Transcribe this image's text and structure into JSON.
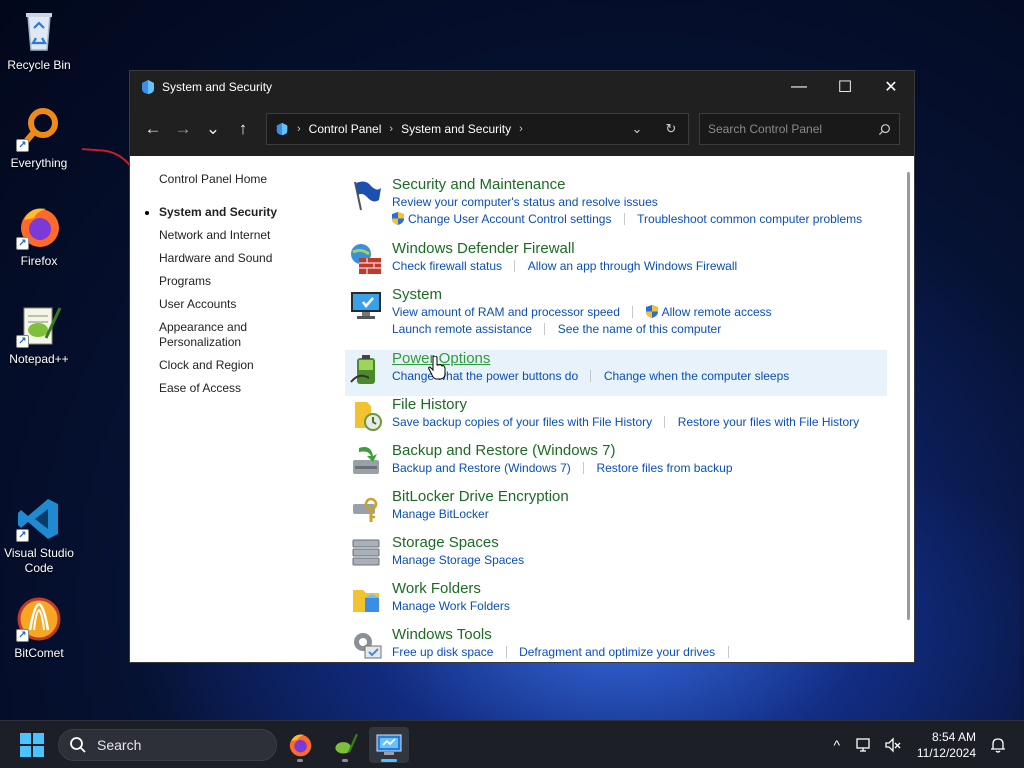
{
  "desktop": {
    "icons": [
      {
        "label": "Recycle Bin"
      },
      {
        "label": "Everything"
      },
      {
        "label": "Firefox"
      },
      {
        "label": "Notepad++"
      },
      {
        "label": "Visual Studio Code"
      },
      {
        "label": "BitComet"
      }
    ]
  },
  "window": {
    "title": "System and Security",
    "controls": {
      "minimize": "—",
      "maximize": "☐",
      "close": "✕"
    }
  },
  "nav": {
    "back": "←",
    "forward": "→",
    "recent": "⌄",
    "up": "↑",
    "breadcrumb": [
      "Control Panel",
      "System and Security"
    ],
    "crumb_sep": "›",
    "dropdown": "⌄",
    "refresh": "↻",
    "search_placeholder": "Search Control Panel"
  },
  "sidebar": {
    "items": [
      {
        "label": "Control Panel Home"
      },
      {
        "label": "System and Security"
      },
      {
        "label": "Network and Internet"
      },
      {
        "label": "Hardware and Sound"
      },
      {
        "label": "Programs"
      },
      {
        "label": "User Accounts"
      },
      {
        "label": "Appearance and Personalization"
      },
      {
        "label": "Clock and Region"
      },
      {
        "label": "Ease of Access"
      }
    ]
  },
  "categories": [
    {
      "title": "Security and Maintenance",
      "icon": "flag-icon",
      "rows": [
        [
          "Review your computer's status and resolve issues"
        ],
        [
          "Change User Account Control settings",
          "Troubleshoot common computer problems"
        ]
      ]
    },
    {
      "title": "Windows Defender Firewall",
      "icon": "firewall-icon",
      "rows": [
        [
          "Check firewall status",
          "Allow an app through Windows Firewall"
        ]
      ]
    },
    {
      "title": "System",
      "icon": "monitor-icon",
      "rows": [
        [
          "View amount of RAM and processor speed",
          "Allow remote access"
        ],
        [
          "Launch remote assistance",
          "See the name of this computer"
        ]
      ]
    },
    {
      "title": "Power Options",
      "icon": "battery-icon",
      "rows": [
        [
          "Change what the power buttons do",
          "Change when the computer sleeps"
        ]
      ]
    },
    {
      "title": "File History",
      "icon": "file-history-icon",
      "rows": [
        [
          "Save backup copies of your files with File History",
          "Restore your files with File History"
        ]
      ]
    },
    {
      "title": "Backup and Restore (Windows 7)",
      "icon": "backup-icon",
      "rows": [
        [
          "Backup and Restore (Windows 7)",
          "Restore files from backup"
        ]
      ]
    },
    {
      "title": "BitLocker Drive Encryption",
      "icon": "bitlocker-icon",
      "rows": [
        [
          "Manage BitLocker"
        ]
      ]
    },
    {
      "title": "Storage Spaces",
      "icon": "storage-icon",
      "rows": [
        [
          "Manage Storage Spaces"
        ]
      ]
    },
    {
      "title": "Work Folders",
      "icon": "work-folders-icon",
      "rows": [
        [
          "Manage Work Folders"
        ]
      ]
    },
    {
      "title": "Windows Tools",
      "icon": "tools-icon",
      "rows": [
        [
          "Free up disk space",
          "Defragment and optimize your drives"
        ]
      ]
    }
  ],
  "taskbar": {
    "search_label": "Search",
    "tray": {
      "chevron": "^",
      "time": "8:54 AM",
      "date": "11/12/2024"
    }
  }
}
